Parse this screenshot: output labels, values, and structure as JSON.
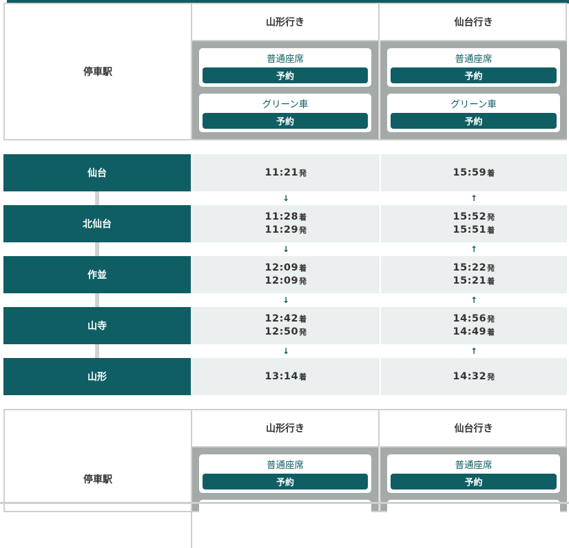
{
  "header": {
    "station_label": "停車駅",
    "columns": [
      {
        "destination": "山形行き",
        "seats": [
          {
            "label": "普通座席",
            "button": "予約"
          },
          {
            "label": "グリーン車",
            "button": "予約"
          }
        ]
      },
      {
        "destination": "仙台行き",
        "seats": [
          {
            "label": "普通座席",
            "button": "予約"
          },
          {
            "label": "グリーン車",
            "button": "予約"
          }
        ]
      }
    ]
  },
  "stops": [
    {
      "name": "仙台",
      "yamagata": [
        {
          "time": "11:21",
          "suffix": "発"
        }
      ],
      "sendai": [
        {
          "time": "15:59",
          "suffix": "着"
        }
      ]
    },
    {
      "name": "北仙台",
      "yamagata": [
        {
          "time": "11:28",
          "suffix": "着"
        },
        {
          "time": "11:29",
          "suffix": "発"
        }
      ],
      "sendai": [
        {
          "time": "15:52",
          "suffix": "発"
        },
        {
          "time": "15:51",
          "suffix": "着"
        }
      ]
    },
    {
      "name": "作並",
      "yamagata": [
        {
          "time": "12:09",
          "suffix": "着"
        },
        {
          "time": "12:09",
          "suffix": "発"
        }
      ],
      "sendai": [
        {
          "time": "15:22",
          "suffix": "発"
        },
        {
          "time": "15:21",
          "suffix": "着"
        }
      ]
    },
    {
      "name": "山寺",
      "yamagata": [
        {
          "time": "12:42",
          "suffix": "着"
        },
        {
          "time": "12:50",
          "suffix": "発"
        }
      ],
      "sendai": [
        {
          "time": "14:56",
          "suffix": "発"
        },
        {
          "time": "14:49",
          "suffix": "着"
        }
      ]
    },
    {
      "name": "山形",
      "yamagata": [
        {
          "time": "13:14",
          "suffix": "着"
        }
      ],
      "sendai": [
        {
          "time": "14:32",
          "suffix": "発"
        }
      ]
    }
  ],
  "arrows": {
    "down": "↓",
    "up": "↑"
  },
  "header2": {
    "station_label": "停車駅",
    "columns": [
      {
        "destination": "山形行き",
        "seats": [
          {
            "label": "普通座席",
            "button": "予約"
          }
        ]
      },
      {
        "destination": "仙台行き",
        "seats": [
          {
            "label": "普通座席",
            "button": "予約"
          }
        ]
      }
    ]
  },
  "colors": {
    "accent": "#0f5e63",
    "seat_bg": "#a4aaa8",
    "time_bg": "#eaf0ef"
  }
}
